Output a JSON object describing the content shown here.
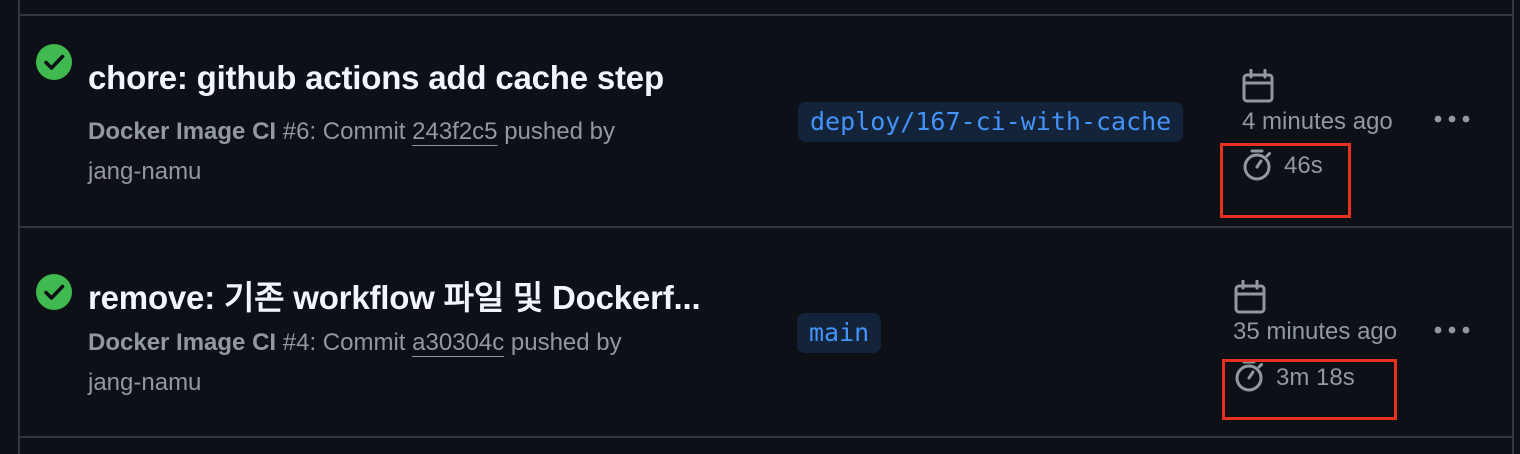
{
  "runs": [
    {
      "status": "success",
      "title": "chore: github actions add cache step",
      "workflow": "Docker Image CI",
      "run_number": "#6",
      "commit_prefix": ": Commit ",
      "commit_sha": "243f2c5",
      "pushed_by_text": " pushed by",
      "actor": "jang-namu",
      "branch": "deploy/167-ci-with-cache",
      "time_ago": "4 minutes ago",
      "duration": "46s"
    },
    {
      "status": "success",
      "title": "remove: 기존 workflow 파일 및 Dockerf...",
      "workflow": "Docker Image CI",
      "run_number": "#4",
      "commit_prefix": ": Commit ",
      "commit_sha": "a30304c",
      "pushed_by_text": " pushed by",
      "actor": "jang-namu",
      "branch": "main",
      "time_ago": "35 minutes ago",
      "duration": "3m 18s"
    }
  ],
  "icons": {
    "status": "check-circle-fill-icon",
    "calendar": "calendar-icon",
    "duration": "stopwatch-icon",
    "menu": "kebab-horizontal-icon"
  },
  "colors": {
    "success": "#3fb950",
    "branch_text": "#4493f8",
    "branch_bg": "#13233a",
    "highlight": "#e8321e",
    "muted": "#9198a1",
    "title": "#f0f6fc"
  }
}
